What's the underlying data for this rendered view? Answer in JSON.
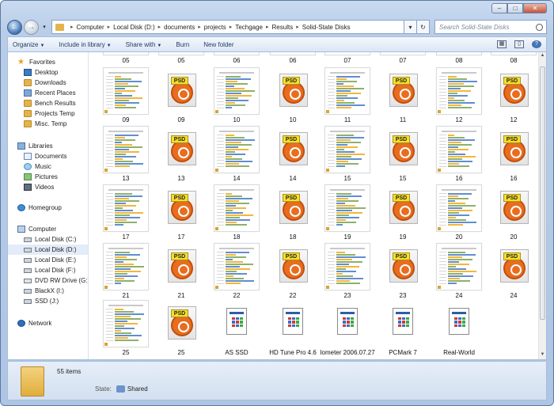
{
  "window": {
    "controls": [
      "minimize",
      "maximize",
      "close"
    ]
  },
  "nav": {
    "back": "back-icon",
    "forward": "forward-icon",
    "breadcrumbs": [
      "Computer",
      "Local Disk (D:)",
      "documents",
      "projects",
      "Techgage",
      "Results",
      "Solid-State Disks"
    ],
    "search_placeholder": "Search Solid-State Disks"
  },
  "toolbar": {
    "organize": "Organize",
    "include": "Include in library",
    "share": "Share with",
    "burn": "Burn",
    "new_folder": "New folder"
  },
  "sidebar": {
    "favorites_label": "Favorites",
    "favorites": [
      "Desktop",
      "Downloads",
      "Recent Places",
      "Bench Results",
      "Projects Temp",
      "Misc. Temp"
    ],
    "libraries_label": "Libraries",
    "libraries": [
      "Documents",
      "Music",
      "Pictures",
      "Videos"
    ],
    "homegroup_label": "Homegroup",
    "computer_label": "Computer",
    "computer": [
      "Local Disk (C:)",
      "Local Disk (D:)",
      "Local Disk (E:)",
      "Local Disk (F:)",
      "DVD RW Drive (G:) A",
      "BlackX (I:)",
      "SSD (J:)"
    ],
    "network_label": "Network"
  },
  "files": {
    "top_row": [
      "05",
      "05",
      "06",
      "06",
      "07",
      "07",
      "08",
      "08"
    ],
    "rows": [
      [
        "09",
        "09",
        "10",
        "10",
        "11",
        "11",
        "12",
        "12"
      ],
      [
        "13",
        "13",
        "14",
        "14",
        "15",
        "15",
        "16",
        "16"
      ],
      [
        "17",
        "17",
        "18",
        "18",
        "19",
        "19",
        "20",
        "20"
      ],
      [
        "21",
        "21",
        "22",
        "22",
        "23",
        "23",
        "24",
        "24"
      ],
      [
        "25",
        "25",
        "AS SSD",
        "HD Tune Pro 4.6",
        "Iometer 2006.07.27",
        "PCMark 7",
        "Real-World"
      ]
    ]
  },
  "details": {
    "count": "55 items",
    "state_label": "State:",
    "state_value": "Shared"
  }
}
